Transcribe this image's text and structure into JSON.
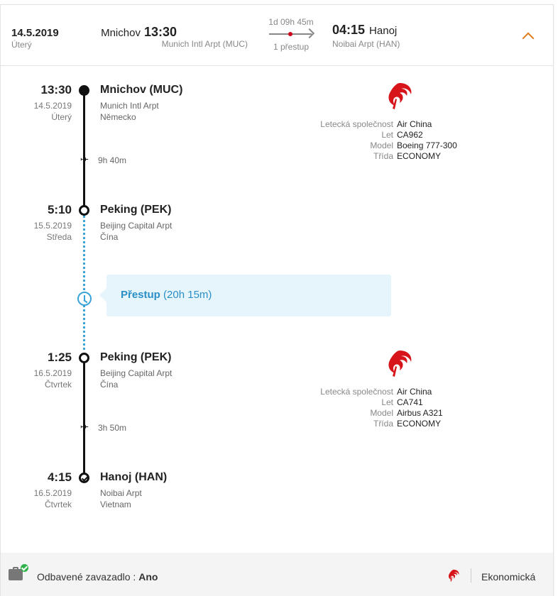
{
  "header": {
    "date": "14.5.2019",
    "day": "Úterý",
    "departure": {
      "city": "Mnichov",
      "time": "13:30",
      "airport": "Munich Intl Arpt (MUC)"
    },
    "duration": "1d 09h 45m",
    "stops": "1 přestup",
    "arrival": {
      "time": "04:15",
      "city": "Hanoj",
      "airport": "Noibai Arpt (HAN)"
    }
  },
  "stops": [
    {
      "time": "13:30",
      "date": "14.5.2019",
      "day": "Úterý",
      "place": "Mnichov (MUC)",
      "airport": "Munich Intl Arpt",
      "country": "Německo"
    },
    {
      "time": "5:10",
      "date": "15.5.2019",
      "day": "Středa",
      "place": "Peking (PEK)",
      "airport": "Beijing Capital Arpt",
      "country": "Čína"
    },
    {
      "time": "1:25",
      "date": "16.5.2019",
      "day": "Čtvrtek",
      "place": "Peking (PEK)",
      "airport": "Beijing Capital Arpt",
      "country": "Čína"
    },
    {
      "time": "4:15",
      "date": "16.5.2019",
      "day": "Čtvrtek",
      "place": "Hanoj (HAN)",
      "airport": "Noibai Arpt",
      "country": "Vietnam"
    }
  ],
  "legs": [
    {
      "duration": "9h 40m",
      "airline": "Air China",
      "flight": "CA962",
      "model": "Boeing 777-300",
      "class": "ECONOMY"
    },
    {
      "duration": "3h 50m",
      "airline": "Air China",
      "flight": "CA741",
      "model": "Airbus A321",
      "class": "ECONOMY"
    }
  ],
  "labels": {
    "airline": "Letecká společnost",
    "flight": "Let",
    "model": "Model",
    "class": "Třída"
  },
  "layover": {
    "label": "Přestup",
    "duration": "(20h 15m)"
  },
  "footer": {
    "baggage_label": "Odbavené zavazadlo :",
    "baggage_value": "Ano",
    "cabin": "Ekonomická"
  },
  "colors": {
    "accent": "#e07b1a",
    "layover": "#2a8fc7",
    "layover_bg": "#e6f4fb",
    "airline_red": "#d7141a",
    "baggage_ok": "#2fb34a"
  },
  "icons": {
    "toggle": "chevron-up-icon",
    "plane": "plane-icon",
    "layover": "clock-icon",
    "baggage": "baggage-icon",
    "airline": "air-china-logo"
  }
}
